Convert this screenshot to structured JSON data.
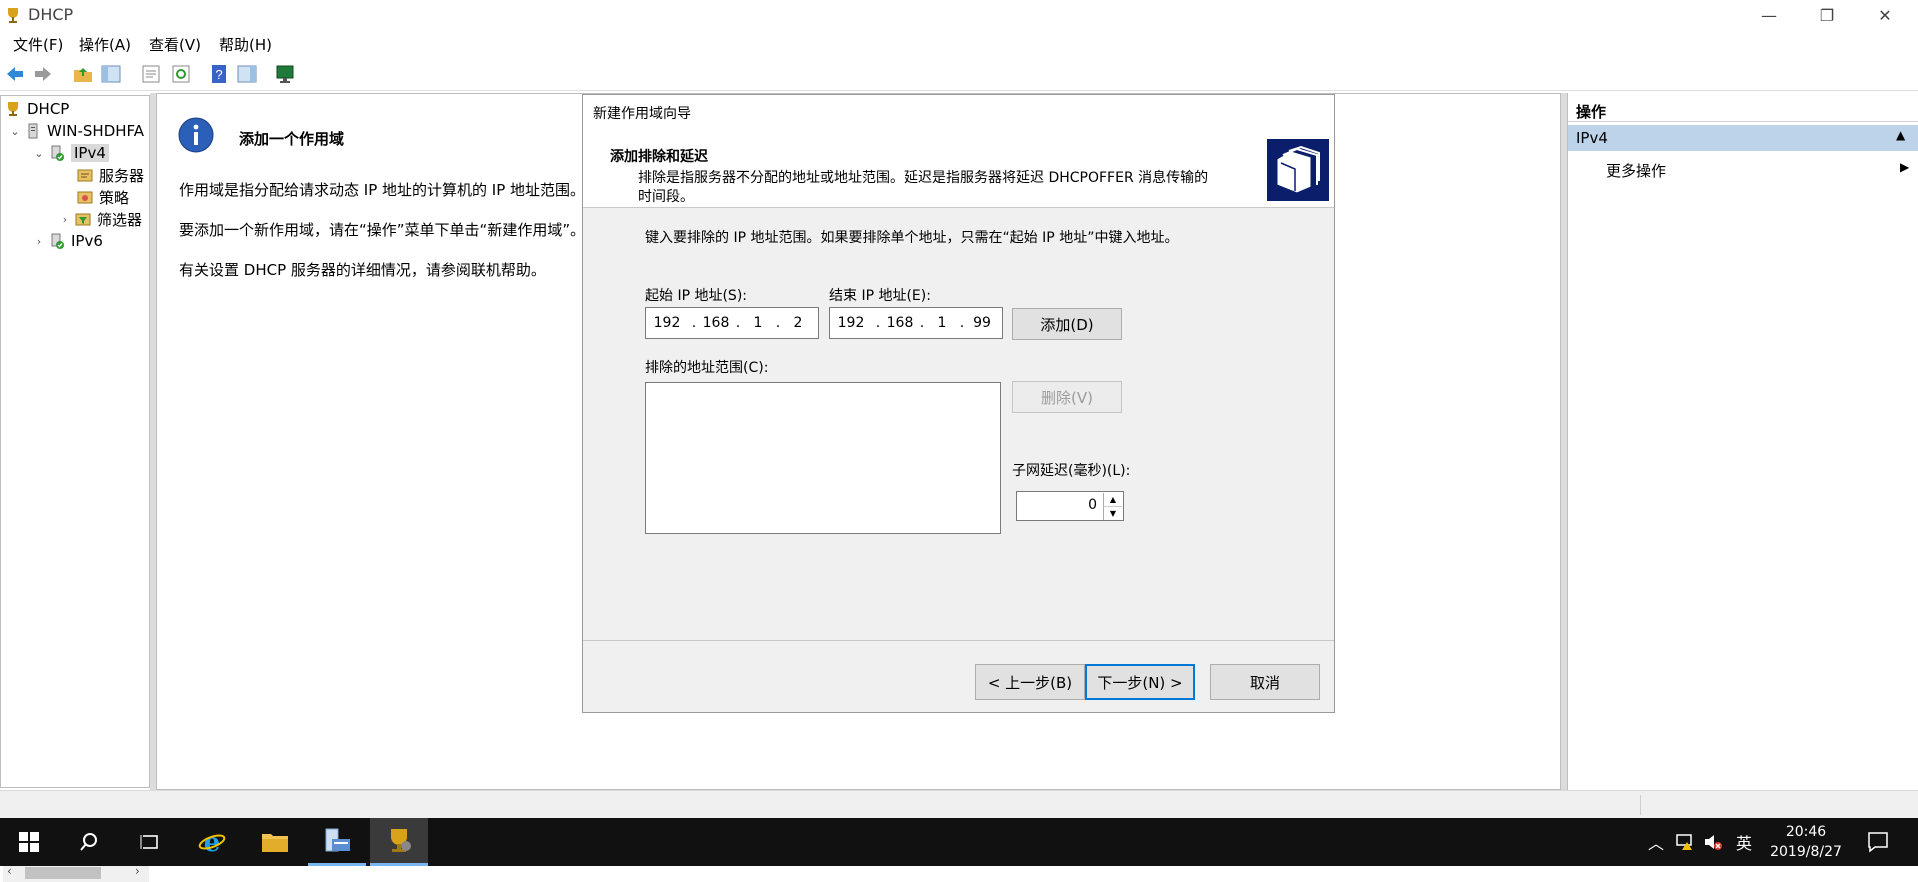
{
  "window": {
    "title": "DHCP",
    "controls": {
      "minimize": "—",
      "restore": "❐",
      "close": "✕"
    }
  },
  "menubar": {
    "items": [
      "文件(F)",
      "操作(A)",
      "查看(V)",
      "帮助(H)"
    ]
  },
  "tree": {
    "root": "DHCP",
    "server": "WIN-SHDHFA",
    "ipv4": "IPv4",
    "children": [
      "服务器",
      "策略",
      "筛选器"
    ],
    "ipv6": "IPv6"
  },
  "center": {
    "heading": "添加一个作用域",
    "paragraphs": [
      "作用域是指分配给请求动态 IP 地址的计算机的 IP 地址范围。你",
      "要添加一个新作用域，请在“操作”菜单下单击“新建作用域”。",
      "有关设置 DHCP 服务器的详细情况，请参阅联机帮助。"
    ]
  },
  "actions": {
    "header": "操作",
    "section": "IPv4",
    "more": "更多操作"
  },
  "dialog": {
    "title": "新建作用域向导",
    "heading": "添加排除和延迟",
    "description_line1": "排除是指服务器不分配的地址或地址范围。延迟是指服务器将延迟 DHCPOFFER 消息传输的",
    "description_line2": "时间段。",
    "instruction": "键入要排除的 IP 地址范围。如果要排除单个地址，只需在“起始 IP 地址”中键入地址。",
    "start_label": "起始 IP 地址(S):",
    "start_ip": [
      "192",
      "168",
      "1",
      "2"
    ],
    "end_label": "结束 IP 地址(E):",
    "end_ip": [
      "192",
      "168",
      "1",
      "99"
    ],
    "add_button": "添加(D)",
    "excluded_label": "排除的地址范围(C):",
    "remove_button": "删除(V)",
    "delay_label": "子网延迟(毫秒)(L):",
    "delay_value": "0",
    "back_button": "< 上一步(B)",
    "next_button": "下一步(N) >",
    "cancel_button": "取消"
  },
  "taskbar": {
    "ime": "英",
    "time": "20:46",
    "date": "2019/8/27"
  }
}
